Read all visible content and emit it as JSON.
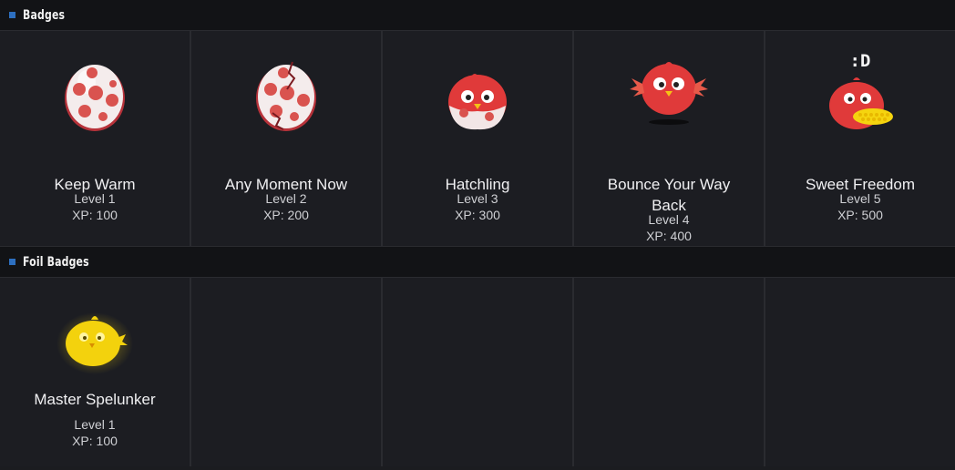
{
  "sections": {
    "badges": {
      "title": "Badges",
      "items": [
        {
          "name": "Keep Warm",
          "level": "Level 1",
          "xp": "XP: 100",
          "icon": "spotted-egg-icon"
        },
        {
          "name": "Any Moment Now",
          "level": "Level 2",
          "xp": "XP: 200",
          "icon": "cracked-egg-icon"
        },
        {
          "name": "Hatchling",
          "level": "Level 3",
          "xp": "XP: 300",
          "icon": "hatchling-bird-icon"
        },
        {
          "name": "Bounce Your Way Back",
          "level": "Level 4",
          "xp": "XP: 400",
          "icon": "bouncing-bird-icon"
        },
        {
          "name": "Sweet Freedom",
          "level": "Level 5",
          "xp": "XP: 500",
          "icon": "bird-with-corn-icon",
          "caption": ":D"
        }
      ]
    },
    "foil_badges": {
      "title": "Foil Badges",
      "items": [
        {
          "name": "Master Spelunker",
          "level": "Level 1",
          "xp": "XP: 100",
          "icon": "gold-bird-icon"
        }
      ]
    }
  },
  "colors": {
    "accent": "#2d6fc0",
    "background": "#1b1c20",
    "header": "#121316",
    "badge_red": "#e03a3a",
    "foil_gold": "#f5d40f"
  }
}
